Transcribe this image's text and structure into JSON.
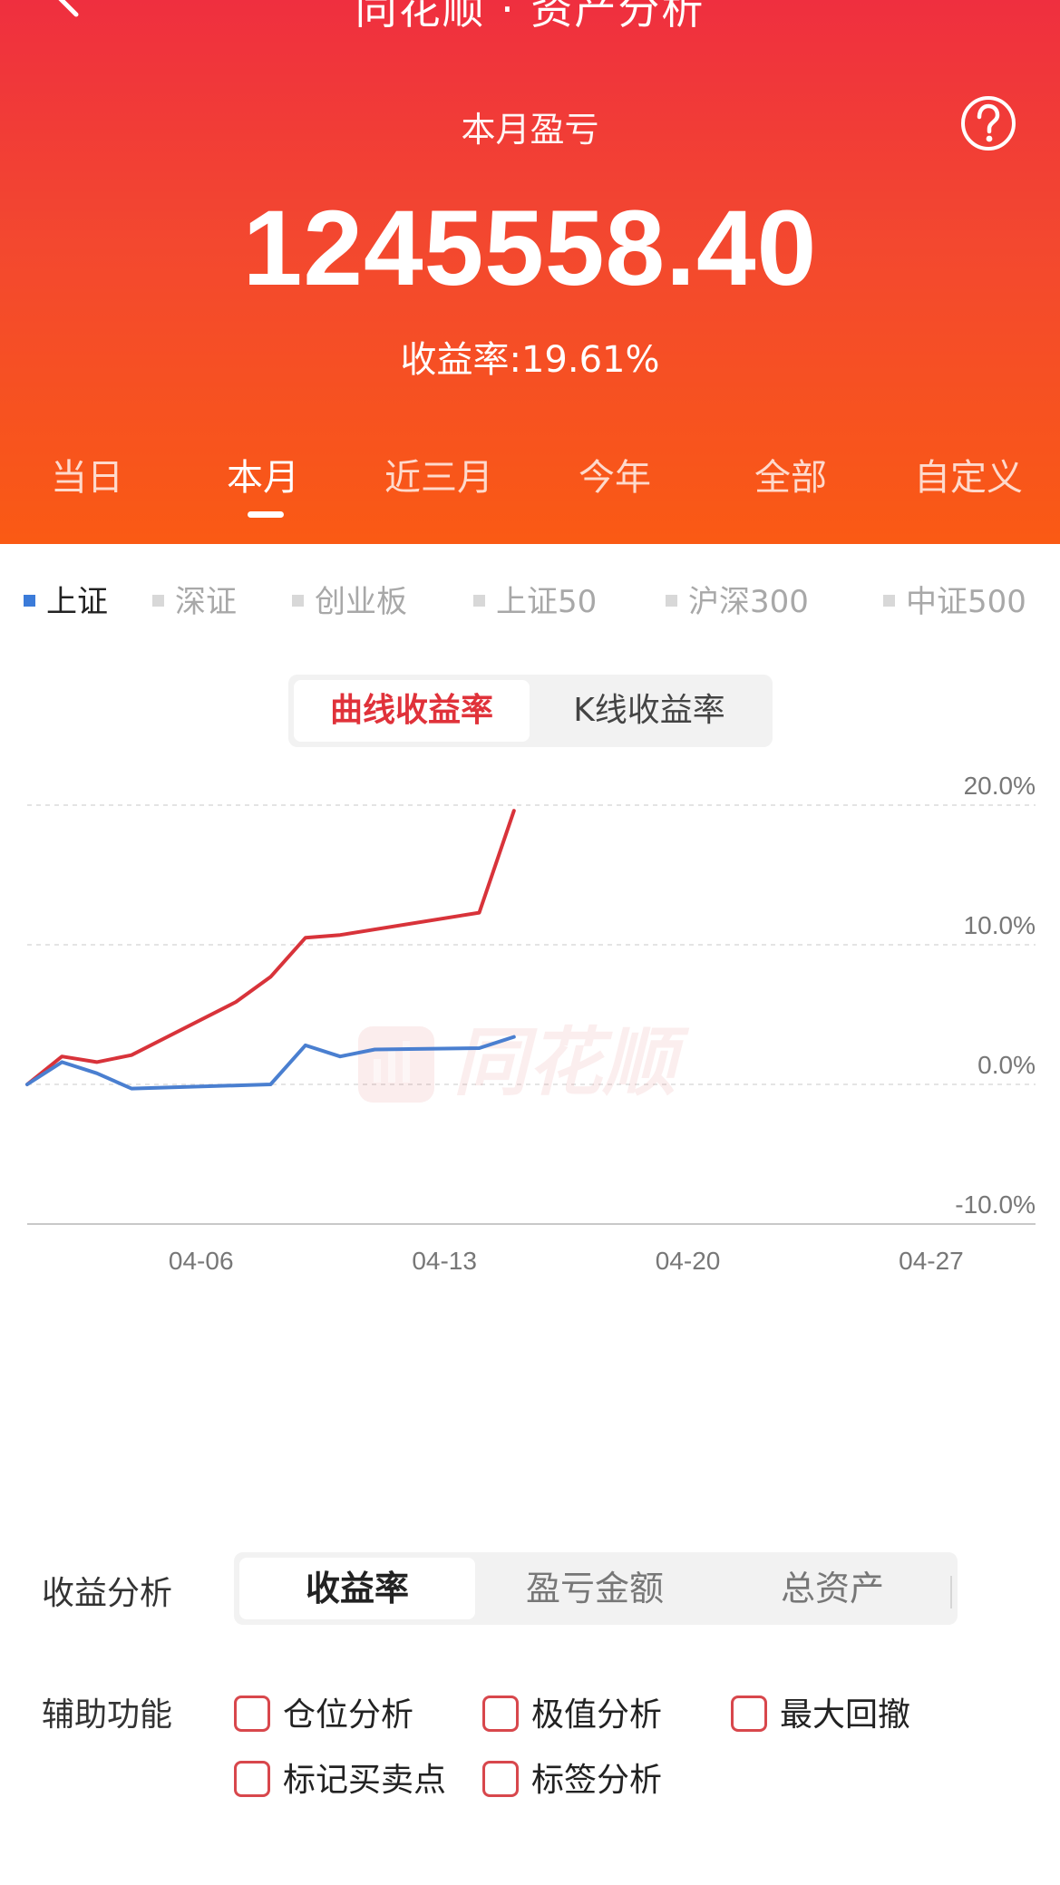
{
  "header": {
    "app_title": "同花顺 · 资产分析",
    "section_label": "本月盈亏",
    "pnl_value": "1245558.40",
    "return_rate": "收益率:19.61%",
    "period_tabs": [
      "当日",
      "本月",
      "近三月",
      "今年",
      "全部",
      "自定义"
    ],
    "active_period": "本月",
    "icons": {
      "back": "chevron-left-icon",
      "help": "question-circle-icon"
    }
  },
  "index_legend": {
    "items": [
      "上证",
      "深证",
      "创业板",
      "上证50",
      "沪深300",
      "中证500"
    ],
    "active": "上证",
    "active_color": "#3b7bd9"
  },
  "chart_toggle": {
    "options": [
      "曲线收益率",
      "K线收益率"
    ],
    "active": "曲线收益率"
  },
  "watermark": {
    "text": "同花顺"
  },
  "chart_data": {
    "type": "line",
    "y_ticks": [
      "20.0%",
      "10.0%",
      "0.0%",
      "-10.0%"
    ],
    "x_ticks": [
      "04-06",
      "04-13",
      "04-20",
      "04-27"
    ],
    "ylim": [
      -10,
      20
    ],
    "x_domain": [
      "04-01",
      "04-30"
    ],
    "grid": true,
    "series": [
      {
        "color": "#d8333a",
        "points": [
          [
            "04-01",
            0.0
          ],
          [
            "04-02",
            2.0
          ],
          [
            "04-03",
            1.6
          ],
          [
            "04-04",
            2.1
          ],
          [
            "04-07",
            5.9
          ],
          [
            "04-08",
            7.7
          ],
          [
            "04-09",
            10.5
          ],
          [
            "04-10",
            10.7
          ],
          [
            "04-14",
            12.3
          ],
          [
            "04-15",
            19.6
          ]
        ]
      },
      {
        "color": "#4a7fd0",
        "points": [
          [
            "04-01",
            0.0
          ],
          [
            "04-02",
            1.6
          ],
          [
            "04-03",
            0.8
          ],
          [
            "04-04",
            -0.3
          ],
          [
            "04-08",
            0.0
          ],
          [
            "04-09",
            2.8
          ],
          [
            "04-10",
            2.0
          ],
          [
            "04-11",
            2.5
          ],
          [
            "04-14",
            2.6
          ],
          [
            "04-15",
            3.4
          ]
        ]
      }
    ]
  },
  "analysis": {
    "label": "收益分析",
    "options": [
      "收益率",
      "盈亏金额",
      "总资产"
    ],
    "active": "收益率"
  },
  "aux": {
    "label": "辅助功能",
    "options": [
      "仓位分析",
      "极值分析",
      "最大回撤",
      "标记买卖点",
      "标签分析"
    ],
    "checkbox_color": "#d8474c"
  }
}
